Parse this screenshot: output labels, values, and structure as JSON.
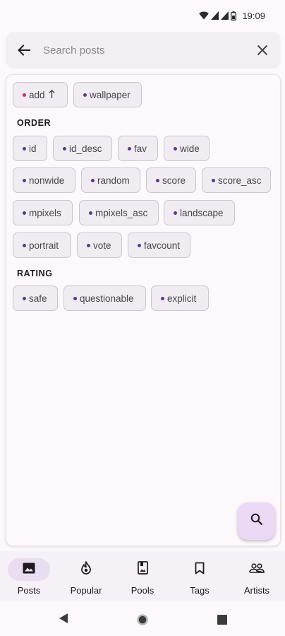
{
  "status_bar": {
    "time": "19:09",
    "icons": [
      "wifi-icon",
      "signal-icon",
      "signal-icon",
      "battery-icon"
    ]
  },
  "search": {
    "placeholder": "Search posts",
    "value": "",
    "back_icon": "arrow-back-icon",
    "clear_icon": "close-icon"
  },
  "chips_top": [
    {
      "label": "add",
      "dot_color": "#e0245e",
      "icon": "arrow-upward-icon"
    },
    {
      "label": "wallpaper",
      "dot_color": "#5a3b88"
    }
  ],
  "order": {
    "title": "ORDER",
    "items": [
      "id",
      "id_desc",
      "fav",
      "wide",
      "nonwide",
      "random",
      "score",
      "score_asc",
      "mpixels",
      "mpixels_asc",
      "landscape",
      "portrait",
      "vote",
      "favcount"
    ]
  },
  "rating": {
    "title": "RATING",
    "items": [
      "safe",
      "questionable",
      "explicit"
    ]
  },
  "fab": {
    "icon": "search-icon"
  },
  "bottom_nav": {
    "items": [
      {
        "label": "Posts",
        "icon": "image-icon",
        "active": true
      },
      {
        "label": "Popular",
        "icon": "fire-icon",
        "active": false
      },
      {
        "label": "Pools",
        "icon": "photo-album-icon",
        "active": false
      },
      {
        "label": "Tags",
        "icon": "bookmark-icon",
        "active": false
      },
      {
        "label": "Artists",
        "icon": "people-icon",
        "active": false
      }
    ]
  },
  "system_nav": [
    "back-triangle-icon",
    "home-circle-icon",
    "recents-square-icon"
  ],
  "colors": {
    "background": "#fdf8fb",
    "chip_background": "#f1ecf1",
    "chip_border": "#cdc6cc",
    "dot_purple": "#5a3b88",
    "dot_pink": "#e0245e",
    "accent": "#e9ddf1",
    "fab": "#ead8f5"
  }
}
